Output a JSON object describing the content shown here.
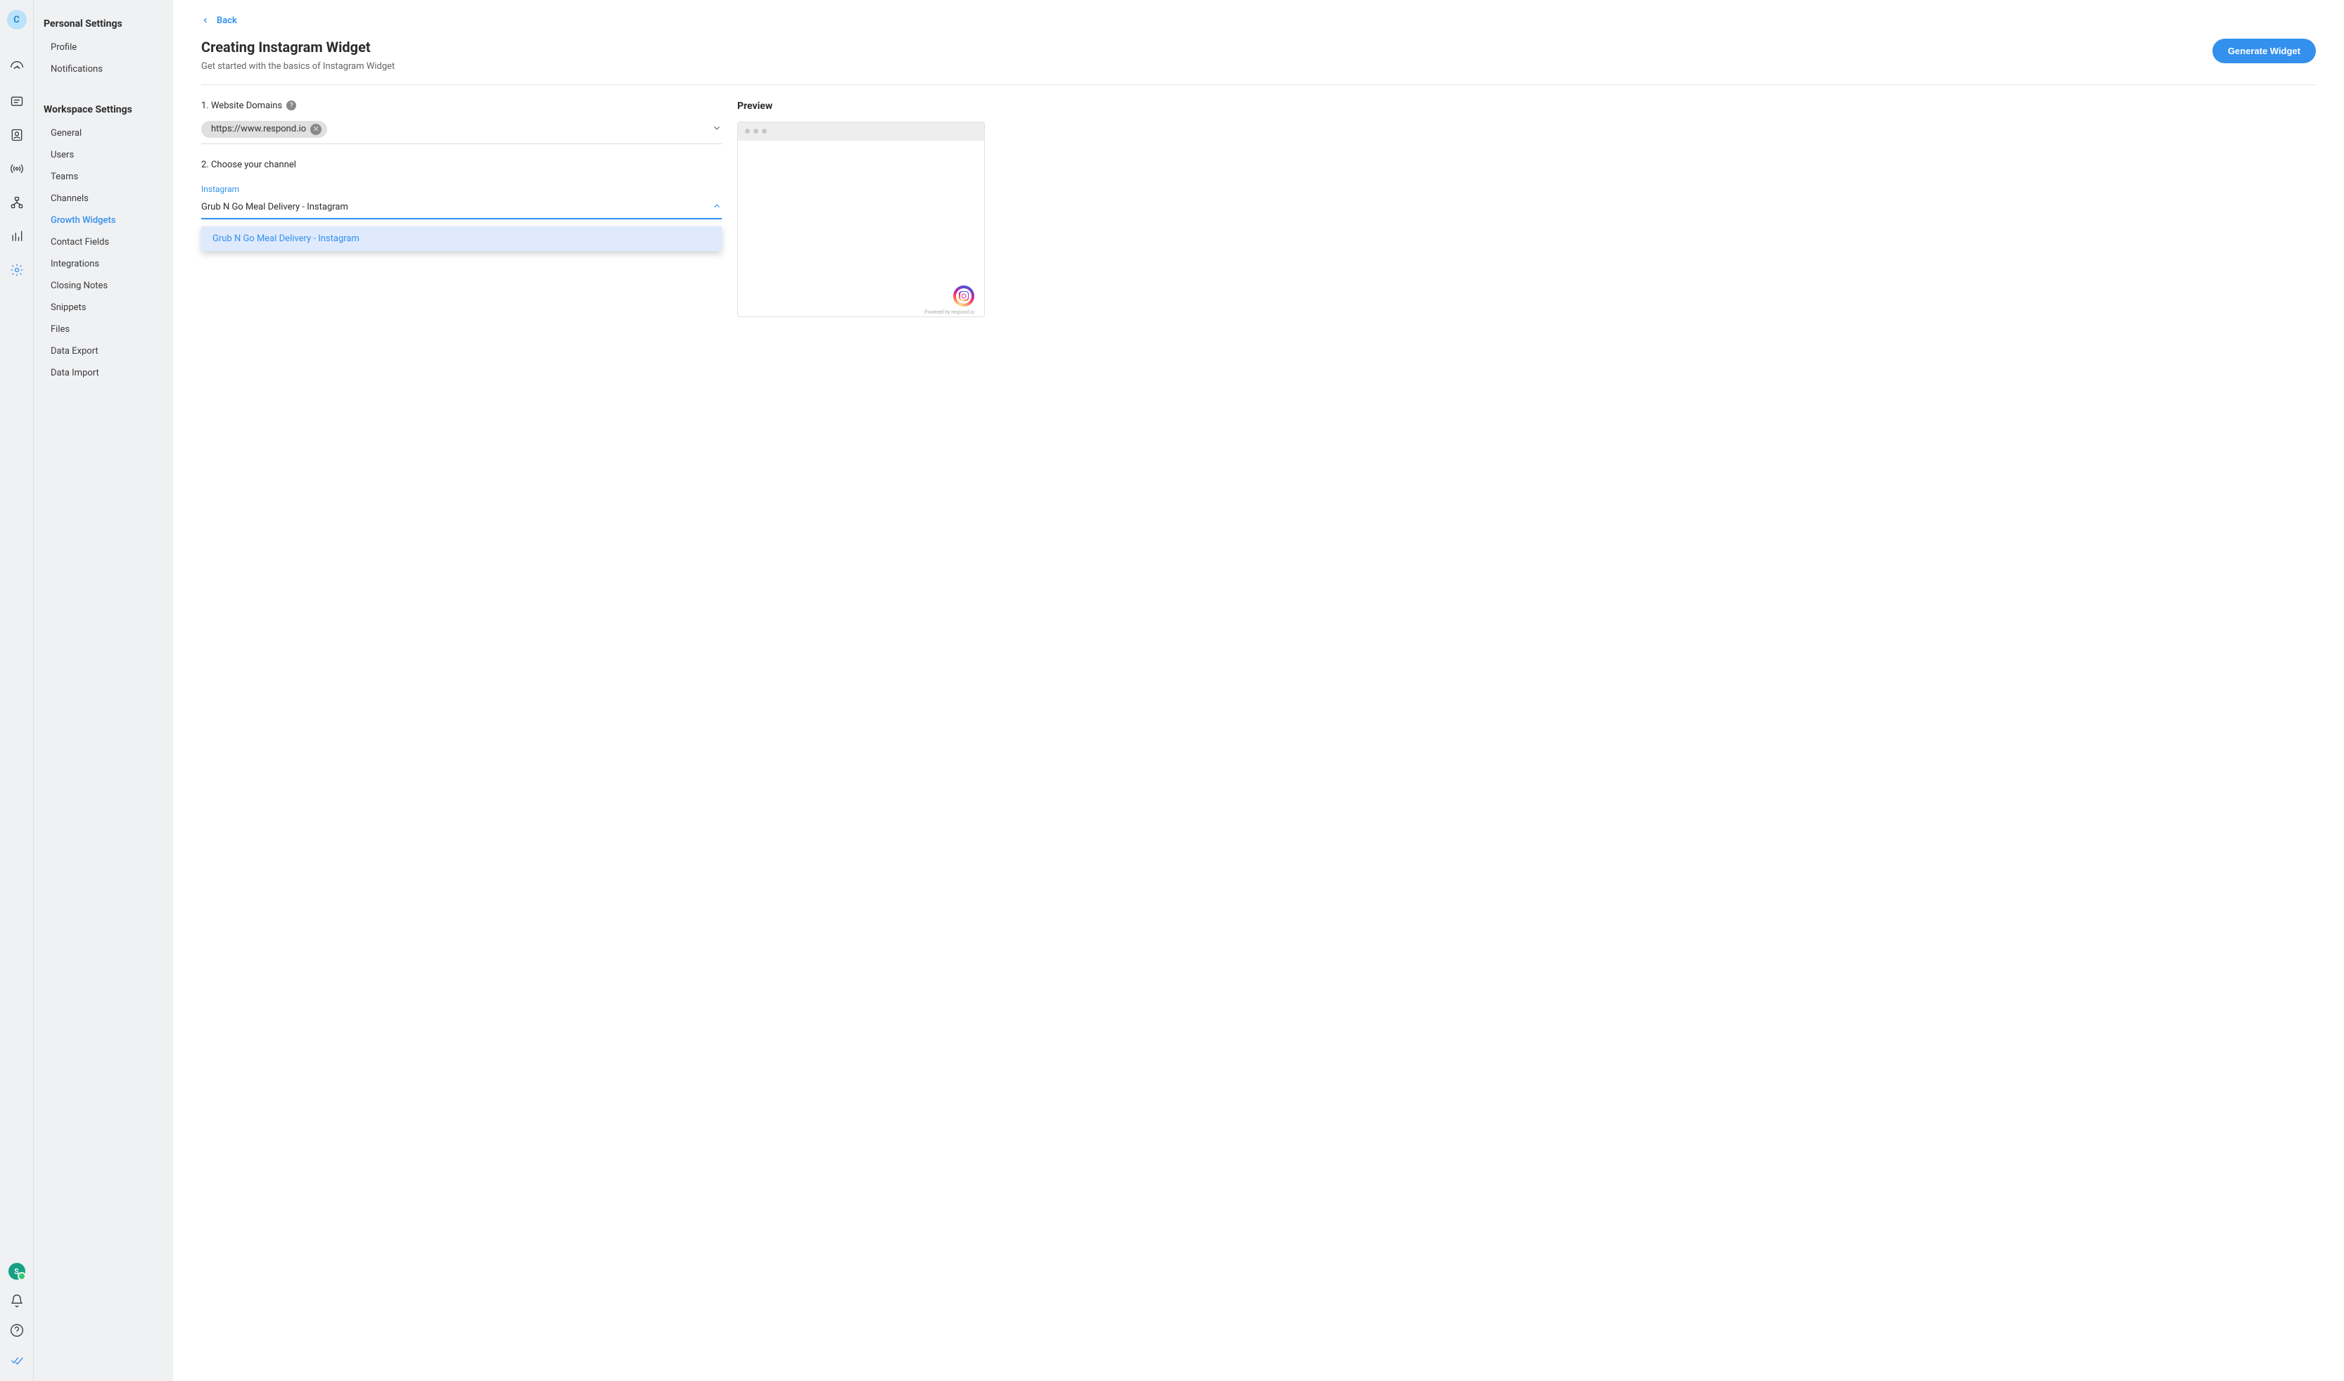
{
  "avatar": {
    "initial": "C"
  },
  "status_avatar": {
    "initial": "S"
  },
  "sidebar": {
    "sections": [
      {
        "title": "Personal Settings",
        "items": [
          {
            "label": "Profile"
          },
          {
            "label": "Notifications"
          }
        ]
      },
      {
        "title": "Workspace Settings",
        "items": [
          {
            "label": "General"
          },
          {
            "label": "Users"
          },
          {
            "label": "Teams"
          },
          {
            "label": "Channels"
          },
          {
            "label": "Growth Widgets",
            "active": true
          },
          {
            "label": "Contact Fields"
          },
          {
            "label": "Integrations"
          },
          {
            "label": "Closing Notes"
          },
          {
            "label": "Snippets"
          },
          {
            "label": "Files"
          },
          {
            "label": "Data Export"
          },
          {
            "label": "Data Import"
          }
        ]
      }
    ]
  },
  "page": {
    "back": "Back",
    "title": "Creating Instagram Widget",
    "subtitle": "Get started with the basics of Instagram Widget",
    "generate_btn": "Generate Widget"
  },
  "form": {
    "step1_label": "1. Website Domains",
    "domain_chip": "https://www.respond.io",
    "step2_label": "2. Choose your channel",
    "channel_type_label": "Instagram",
    "selected_channel": "Grub N Go Meal Delivery - Instagram",
    "dropdown_options": [
      "Grub N Go Meal Delivery - Instagram"
    ]
  },
  "preview": {
    "title": "Preview",
    "powered": "Powered by respond.io"
  }
}
